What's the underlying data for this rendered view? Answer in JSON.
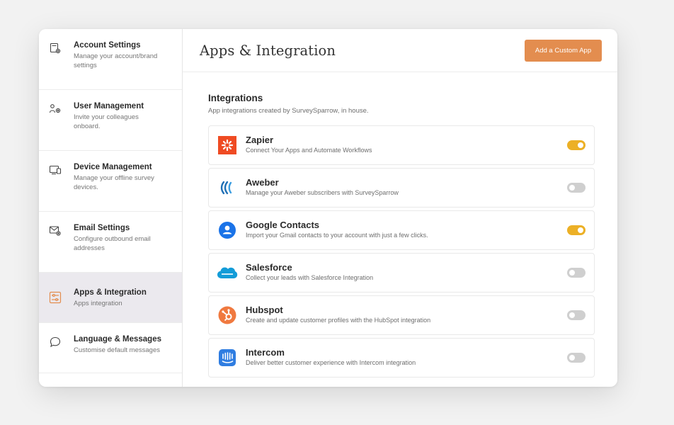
{
  "sidebar": {
    "items": [
      {
        "title": "Account Settings",
        "subtitle": "Manage your account/brand settings",
        "icon": "account-settings-icon"
      },
      {
        "title": "User Management",
        "subtitle": "Invite your colleagues onboard.",
        "icon": "user-management-icon"
      },
      {
        "title": "Device Management",
        "subtitle": "Manage your offline survey devices.",
        "icon": "device-icon"
      },
      {
        "title": "Email Settings",
        "subtitle": "Configure outbound email addresses",
        "icon": "email-settings-icon"
      },
      {
        "title": "Apps & Integration",
        "subtitle": "Apps integration",
        "icon": "apps-integration-icon",
        "active": true
      },
      {
        "title": "Language & Messages",
        "subtitle": "Customise default messages",
        "icon": "chat-bubble-icon"
      }
    ]
  },
  "header": {
    "title": "Apps & Integration",
    "add_button_label": "Add a Custom App"
  },
  "integrations": {
    "title": "Integrations",
    "subtitle": "App integrations created by SurveySparrow, in house.",
    "items": [
      {
        "name": "Zapier",
        "description": "Connect Your Apps and Automate Workflows",
        "enabled": true,
        "icon": "zapier-logo-icon"
      },
      {
        "name": "Aweber",
        "description": "Manage your Aweber subscribers with SurveySparrow",
        "enabled": false,
        "icon": "aweber-logo-icon"
      },
      {
        "name": "Google Contacts",
        "description": "Import your Gmail contacts to your account with just a few clicks.",
        "enabled": true,
        "icon": "google-contacts-logo-icon"
      },
      {
        "name": "Salesforce",
        "description": "Collect your leads with Salesforce Integration",
        "enabled": false,
        "icon": "salesforce-logo-icon"
      },
      {
        "name": "Hubspot",
        "description": "Create and update customer profiles with the HubSpot integration",
        "enabled": false,
        "icon": "hubspot-logo-icon"
      },
      {
        "name": "Intercom",
        "description": "Deliver better customer experience with Intercom integration",
        "enabled": false,
        "icon": "intercom-logo-icon"
      }
    ]
  },
  "colors": {
    "accent_button": "#e38d4f",
    "toggle_on": "#ecb026",
    "toggle_off": "#cfcfcf",
    "sidebar_active": "#ebe9ee"
  }
}
